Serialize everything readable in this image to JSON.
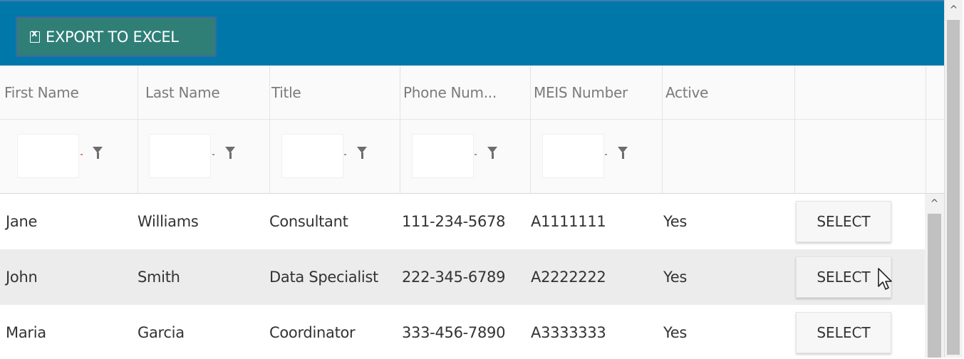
{
  "toolbar": {
    "export_label": "EXPORT TO EXCEL",
    "export_icon": "excel-file-icon",
    "background": "#0077a9",
    "button_color": "#2f7f77"
  },
  "columns": [
    {
      "key": "first_name",
      "label": "First Name"
    },
    {
      "key": "last_name",
      "label": "Last Name"
    },
    {
      "key": "title",
      "label": "Title"
    },
    {
      "key": "phone",
      "label": "Phone Num..."
    },
    {
      "key": "meis",
      "label": "MEIS Number"
    },
    {
      "key": "active",
      "label": "Active"
    },
    {
      "key": "action",
      "label": ""
    }
  ],
  "filters": {
    "icon": "filter-icon",
    "values": [
      "",
      "",
      "",
      "",
      ""
    ]
  },
  "rows": [
    {
      "first_name": "Jane",
      "last_name": "Williams",
      "title": "Consultant",
      "phone": "111-234-5678",
      "meis": "A1111111",
      "active": "Yes",
      "action": "SELECT"
    },
    {
      "first_name": "John",
      "last_name": "Smith",
      "title": "Data Specialist",
      "phone": "222-345-6789",
      "meis": "A2222222",
      "active": "Yes",
      "action": "SELECT"
    },
    {
      "first_name": "Maria",
      "last_name": "Garcia",
      "title": "Coordinator",
      "phone": "333-456-7890",
      "meis": "A3333333",
      "active": "Yes",
      "action": "SELECT"
    }
  ],
  "scrollbar": {
    "up_glyph": "^"
  }
}
